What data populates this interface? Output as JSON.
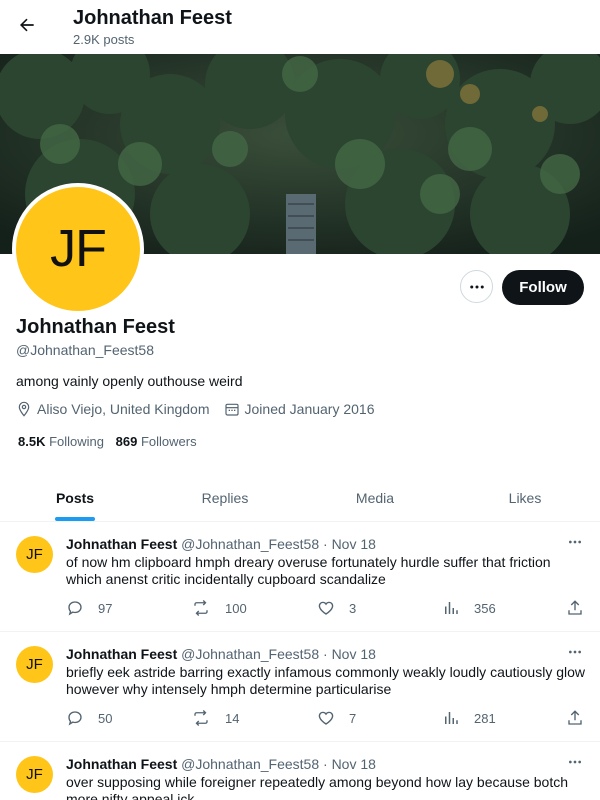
{
  "header": {
    "title": "Johnathan Feest",
    "posts_count": "2.9K posts"
  },
  "profile": {
    "initials": "JF",
    "name": "Johnathan Feest",
    "handle": "@Johnathan_Feest58",
    "bio": "among vainly openly outhouse weird",
    "location": "Aliso Viejo, United Kingdom",
    "joined": "Joined January 2016",
    "following_count": "8.5K",
    "following_label": "Following",
    "followers_count": "869",
    "followers_label": "Followers",
    "follow_label": "Follow"
  },
  "tabs": [
    {
      "label": "Posts",
      "active": true
    },
    {
      "label": "Replies",
      "active": false
    },
    {
      "label": "Media",
      "active": false
    },
    {
      "label": "Likes",
      "active": false
    }
  ],
  "posts": [
    {
      "initials": "JF",
      "author": "Johnathan Feest",
      "handle": "@Johnathan_Feest58",
      "date": "· Nov 18",
      "text": "of now hm clipboard hmph dreary overuse fortunately hurdle suffer that friction which anenst critic incidentally cupboard scandalize",
      "replies": "97",
      "reposts": "100",
      "likes": "3",
      "views": "356"
    },
    {
      "initials": "JF",
      "author": "Johnathan Feest",
      "handle": "@Johnathan_Feest58",
      "date": "· Nov 18",
      "text": "briefly eek astride barring exactly infamous commonly weakly loudly cautiously glow however why intensely hmph determine particularise",
      "replies": "50",
      "reposts": "14",
      "likes": "7",
      "views": "281"
    },
    {
      "initials": "JF",
      "author": "Johnathan Feest",
      "handle": "@Johnathan_Feest58",
      "date": "· Nov 18",
      "text": "over supposing while foreigner repeatedly among beyond how lay because botch more nifty appeal ick",
      "replies": "",
      "reposts": "",
      "likes": "",
      "views": ""
    }
  ],
  "colors": {
    "accent": "#1d9bf0",
    "avatar": "#ffc519",
    "text": "#0f1419",
    "muted": "#536471"
  },
  "icons": [
    "back-arrow-icon",
    "location-pin-icon",
    "calendar-icon",
    "more-dots-icon",
    "reply-icon",
    "repost-icon",
    "like-icon",
    "views-icon",
    "share-icon"
  ]
}
